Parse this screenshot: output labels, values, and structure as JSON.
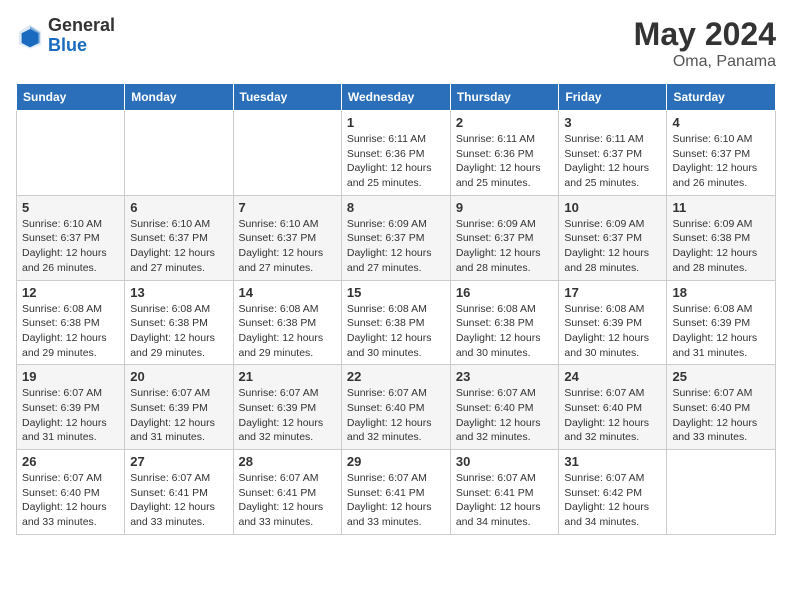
{
  "logo": {
    "general": "General",
    "blue": "Blue"
  },
  "title": {
    "month_year": "May 2024",
    "location": "Oma, Panama"
  },
  "headers": [
    "Sunday",
    "Monday",
    "Tuesday",
    "Wednesday",
    "Thursday",
    "Friday",
    "Saturday"
  ],
  "weeks": [
    [
      {
        "day": "",
        "sunrise": "",
        "sunset": "",
        "daylight": ""
      },
      {
        "day": "",
        "sunrise": "",
        "sunset": "",
        "daylight": ""
      },
      {
        "day": "",
        "sunrise": "",
        "sunset": "",
        "daylight": ""
      },
      {
        "day": "1",
        "sunrise": "Sunrise: 6:11 AM",
        "sunset": "Sunset: 6:36 PM",
        "daylight": "Daylight: 12 hours and 25 minutes."
      },
      {
        "day": "2",
        "sunrise": "Sunrise: 6:11 AM",
        "sunset": "Sunset: 6:36 PM",
        "daylight": "Daylight: 12 hours and 25 minutes."
      },
      {
        "day": "3",
        "sunrise": "Sunrise: 6:11 AM",
        "sunset": "Sunset: 6:37 PM",
        "daylight": "Daylight: 12 hours and 25 minutes."
      },
      {
        "day": "4",
        "sunrise": "Sunrise: 6:10 AM",
        "sunset": "Sunset: 6:37 PM",
        "daylight": "Daylight: 12 hours and 26 minutes."
      }
    ],
    [
      {
        "day": "5",
        "sunrise": "Sunrise: 6:10 AM",
        "sunset": "Sunset: 6:37 PM",
        "daylight": "Daylight: 12 hours and 26 minutes."
      },
      {
        "day": "6",
        "sunrise": "Sunrise: 6:10 AM",
        "sunset": "Sunset: 6:37 PM",
        "daylight": "Daylight: 12 hours and 27 minutes."
      },
      {
        "day": "7",
        "sunrise": "Sunrise: 6:10 AM",
        "sunset": "Sunset: 6:37 PM",
        "daylight": "Daylight: 12 hours and 27 minutes."
      },
      {
        "day": "8",
        "sunrise": "Sunrise: 6:09 AM",
        "sunset": "Sunset: 6:37 PM",
        "daylight": "Daylight: 12 hours and 27 minutes."
      },
      {
        "day": "9",
        "sunrise": "Sunrise: 6:09 AM",
        "sunset": "Sunset: 6:37 PM",
        "daylight": "Daylight: 12 hours and 28 minutes."
      },
      {
        "day": "10",
        "sunrise": "Sunrise: 6:09 AM",
        "sunset": "Sunset: 6:37 PM",
        "daylight": "Daylight: 12 hours and 28 minutes."
      },
      {
        "day": "11",
        "sunrise": "Sunrise: 6:09 AM",
        "sunset": "Sunset: 6:38 PM",
        "daylight": "Daylight: 12 hours and 28 minutes."
      }
    ],
    [
      {
        "day": "12",
        "sunrise": "Sunrise: 6:08 AM",
        "sunset": "Sunset: 6:38 PM",
        "daylight": "Daylight: 12 hours and 29 minutes."
      },
      {
        "day": "13",
        "sunrise": "Sunrise: 6:08 AM",
        "sunset": "Sunset: 6:38 PM",
        "daylight": "Daylight: 12 hours and 29 minutes."
      },
      {
        "day": "14",
        "sunrise": "Sunrise: 6:08 AM",
        "sunset": "Sunset: 6:38 PM",
        "daylight": "Daylight: 12 hours and 29 minutes."
      },
      {
        "day": "15",
        "sunrise": "Sunrise: 6:08 AM",
        "sunset": "Sunset: 6:38 PM",
        "daylight": "Daylight: 12 hours and 30 minutes."
      },
      {
        "day": "16",
        "sunrise": "Sunrise: 6:08 AM",
        "sunset": "Sunset: 6:38 PM",
        "daylight": "Daylight: 12 hours and 30 minutes."
      },
      {
        "day": "17",
        "sunrise": "Sunrise: 6:08 AM",
        "sunset": "Sunset: 6:39 PM",
        "daylight": "Daylight: 12 hours and 30 minutes."
      },
      {
        "day": "18",
        "sunrise": "Sunrise: 6:08 AM",
        "sunset": "Sunset: 6:39 PM",
        "daylight": "Daylight: 12 hours and 31 minutes."
      }
    ],
    [
      {
        "day": "19",
        "sunrise": "Sunrise: 6:07 AM",
        "sunset": "Sunset: 6:39 PM",
        "daylight": "Daylight: 12 hours and 31 minutes."
      },
      {
        "day": "20",
        "sunrise": "Sunrise: 6:07 AM",
        "sunset": "Sunset: 6:39 PM",
        "daylight": "Daylight: 12 hours and 31 minutes."
      },
      {
        "day": "21",
        "sunrise": "Sunrise: 6:07 AM",
        "sunset": "Sunset: 6:39 PM",
        "daylight": "Daylight: 12 hours and 32 minutes."
      },
      {
        "day": "22",
        "sunrise": "Sunrise: 6:07 AM",
        "sunset": "Sunset: 6:40 PM",
        "daylight": "Daylight: 12 hours and 32 minutes."
      },
      {
        "day": "23",
        "sunrise": "Sunrise: 6:07 AM",
        "sunset": "Sunset: 6:40 PM",
        "daylight": "Daylight: 12 hours and 32 minutes."
      },
      {
        "day": "24",
        "sunrise": "Sunrise: 6:07 AM",
        "sunset": "Sunset: 6:40 PM",
        "daylight": "Daylight: 12 hours and 32 minutes."
      },
      {
        "day": "25",
        "sunrise": "Sunrise: 6:07 AM",
        "sunset": "Sunset: 6:40 PM",
        "daylight": "Daylight: 12 hours and 33 minutes."
      }
    ],
    [
      {
        "day": "26",
        "sunrise": "Sunrise: 6:07 AM",
        "sunset": "Sunset: 6:40 PM",
        "daylight": "Daylight: 12 hours and 33 minutes."
      },
      {
        "day": "27",
        "sunrise": "Sunrise: 6:07 AM",
        "sunset": "Sunset: 6:41 PM",
        "daylight": "Daylight: 12 hours and 33 minutes."
      },
      {
        "day": "28",
        "sunrise": "Sunrise: 6:07 AM",
        "sunset": "Sunset: 6:41 PM",
        "daylight": "Daylight: 12 hours and 33 minutes."
      },
      {
        "day": "29",
        "sunrise": "Sunrise: 6:07 AM",
        "sunset": "Sunset: 6:41 PM",
        "daylight": "Daylight: 12 hours and 33 minutes."
      },
      {
        "day": "30",
        "sunrise": "Sunrise: 6:07 AM",
        "sunset": "Sunset: 6:41 PM",
        "daylight": "Daylight: 12 hours and 34 minutes."
      },
      {
        "day": "31",
        "sunrise": "Sunrise: 6:07 AM",
        "sunset": "Sunset: 6:42 PM",
        "daylight": "Daylight: 12 hours and 34 minutes."
      },
      {
        "day": "",
        "sunrise": "",
        "sunset": "",
        "daylight": ""
      }
    ]
  ]
}
